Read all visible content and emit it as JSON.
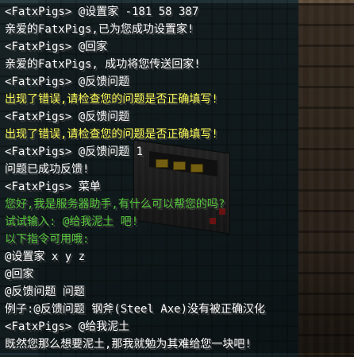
{
  "chat": {
    "lines": [
      {
        "text": "<FatxPigs> @设置家 -181 58 387",
        "color": "white"
      },
      {
        "text": "亲爱的FatxPigs,已为您成功设置家!",
        "color": "white"
      },
      {
        "text": "<FatxPigs> @回家",
        "color": "white"
      },
      {
        "text": "亲爱的FatxPigs, 成功将您传送回家!",
        "color": "white"
      },
      {
        "text": "<FatxPigs> @反馈问题",
        "color": "white"
      },
      {
        "text": "出现了错误,请检查您的问题是否正确填写!",
        "color": "yellow"
      },
      {
        "text": "<FatxPigs> @反馈问题",
        "color": "white"
      },
      {
        "text": "出现了错误,请检查您的问题是否正确填写!",
        "color": "yellow"
      },
      {
        "text": "<FatxPigs> @反馈问题 1",
        "color": "white"
      },
      {
        "text": "问题已成功反馈!",
        "color": "white"
      },
      {
        "text": "<FatxPigs> 菜单",
        "color": "white"
      },
      {
        "text": "您好,我是服务器助手,有什么可以帮您的吗?",
        "color": "green"
      },
      {
        "text": "试试输入: @给我泥土 吧!",
        "color": "green"
      },
      {
        "text": "以下指令可用哦:",
        "color": "green"
      },
      {
        "text": "@设置家 x y z",
        "color": "white"
      },
      {
        "text": "@回家",
        "color": "white"
      },
      {
        "text": "@反馈问题 问题",
        "color": "white"
      },
      {
        "text": "例子:@反馈问题 钢斧(Steel Axe)没有被正确汉化",
        "color": "white"
      },
      {
        "text": "<FatxPigs> @给我泥土",
        "color": "white"
      },
      {
        "text": "既然您那么想要泥土,那我就勉为其难给您一块吧!",
        "color": "white"
      }
    ]
  },
  "colors": {
    "white": "#ffffff",
    "yellow": "#ffff55",
    "green": "#55c83a"
  }
}
